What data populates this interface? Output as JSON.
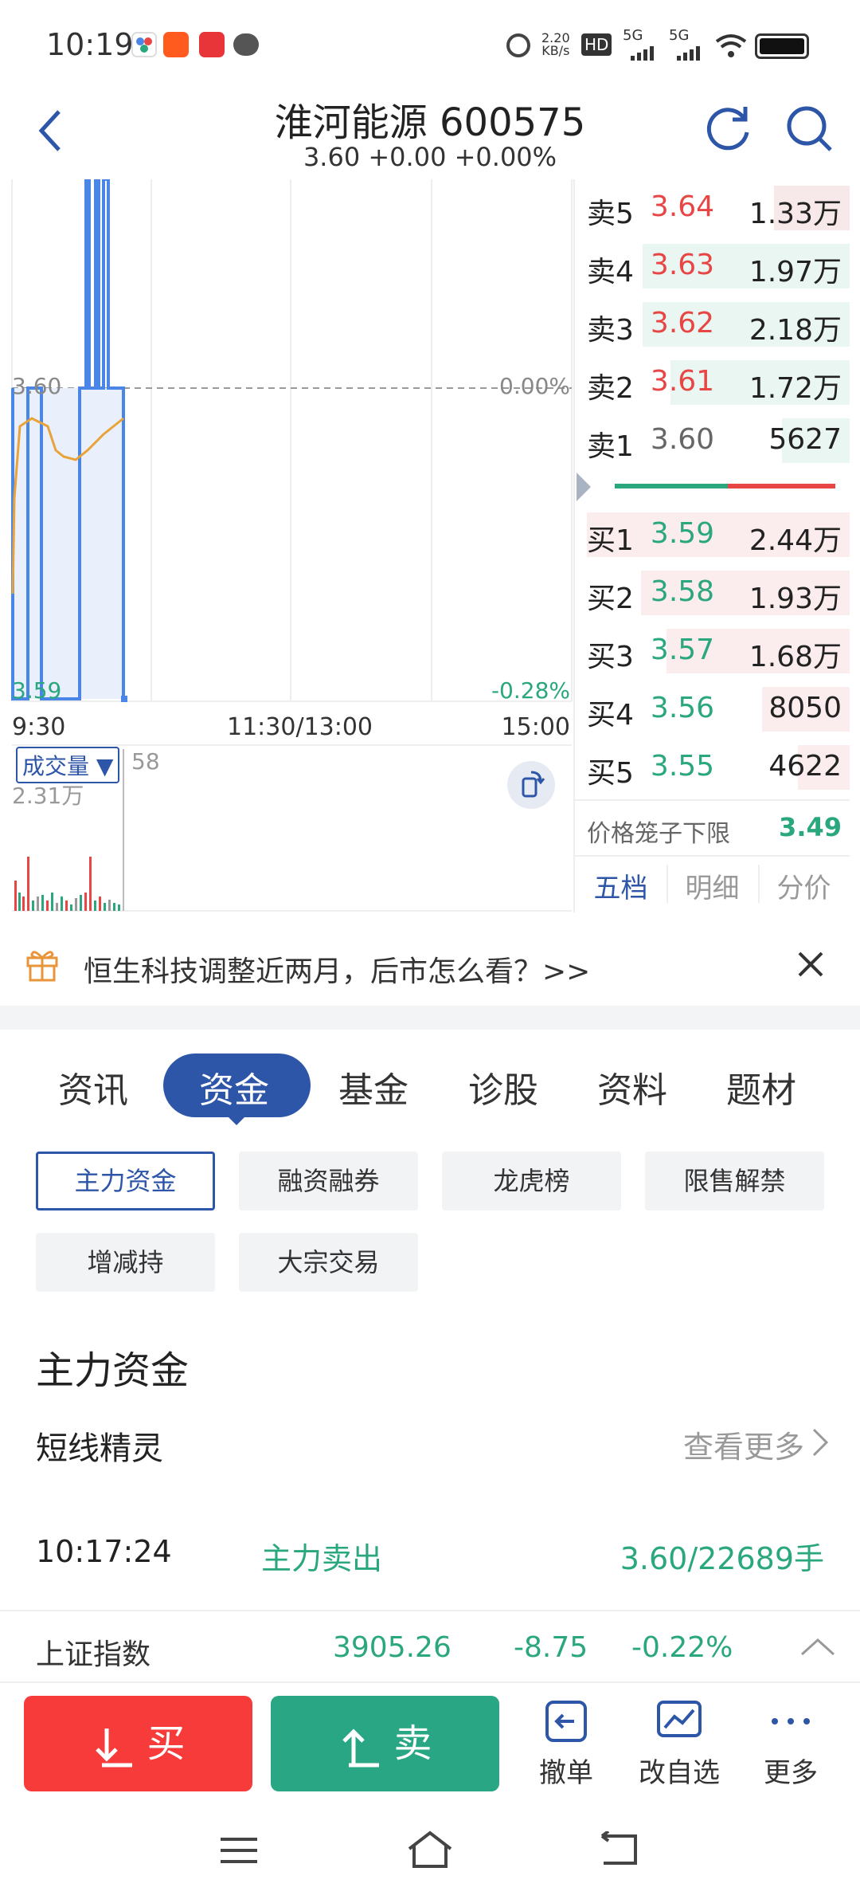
{
  "status_bar": {
    "time": "10:19",
    "speed_value": "2.20",
    "speed_unit": "KB/s",
    "hd": "HD",
    "net1": "5G",
    "net2": "5G",
    "icons": [
      "taobao-app-icon",
      "app-icon-2",
      "message-icon",
      "alarm-icon",
      "wifi-icon",
      "battery-icon"
    ]
  },
  "header": {
    "title": "淮河能源 600575",
    "subtitle": "3.60 +0.00 +0.00%"
  },
  "chart": {
    "price_top": "3.60",
    "pct_top": "0.00%",
    "price_bottom": "3.59",
    "pct_bottom": "-0.28%",
    "time_start": "9:30",
    "time_mid": "11:30/13:00",
    "time_end": "15:00",
    "volume_selector": "成交量 ▼",
    "volume_value": "58",
    "volume_max": "2.31万"
  },
  "chart_data": {
    "type": "line",
    "xlabel": "",
    "ylabel": "",
    "x_ticks": [
      "9:30",
      "11:30/13:00",
      "15:00"
    ],
    "ylim": [
      3.59,
      3.6
    ],
    "series": [],
    "avg_price_color": "#e8a33a",
    "price_color": "#4a86e8"
  },
  "orderbook": {
    "asks": [
      {
        "label": "卖5",
        "price": "3.64",
        "volume": "1.33万"
      },
      {
        "label": "卖4",
        "price": "3.63",
        "volume": "1.97万"
      },
      {
        "label": "卖3",
        "price": "3.62",
        "volume": "2.18万"
      },
      {
        "label": "卖2",
        "price": "3.61",
        "volume": "1.72万"
      },
      {
        "label": "卖1",
        "price": "3.60",
        "volume": "5627"
      }
    ],
    "bids": [
      {
        "label": "买1",
        "price": "3.59",
        "volume": "2.44万"
      },
      {
        "label": "买2",
        "price": "3.58",
        "volume": "1.93万"
      },
      {
        "label": "买3",
        "price": "3.57",
        "volume": "1.68万"
      },
      {
        "label": "买4",
        "price": "3.56",
        "volume": "8050"
      },
      {
        "label": "买5",
        "price": "3.55",
        "volume": "4622"
      }
    ],
    "limit_label": "价格笼子下限",
    "limit_value": "3.49",
    "tabs": [
      "五档",
      "明细",
      "分价"
    ]
  },
  "banner": {
    "text": "恒生科技调整近两月，后市怎么看？>>"
  },
  "main_tabs": [
    "资讯",
    "资金",
    "基金",
    "诊股",
    "资料",
    "题材"
  ],
  "chips": [
    "主力资金",
    "融资融券",
    "龙虎榜",
    "限售解禁",
    "增减持",
    "大宗交易"
  ],
  "section": {
    "title": "主力资金",
    "subtitle": "短线精灵",
    "more": "查看更多"
  },
  "flow": {
    "time": "10:17:24",
    "type": "主力卖出",
    "detail": "3.60/22689手"
  },
  "index_bar": {
    "name": "上证指数",
    "value": "3905.26",
    "change": "-8.75",
    "pct": "-0.22%"
  },
  "actions": {
    "buy": "买",
    "sell": "卖",
    "cancel": "撤单",
    "edit_watch": "改自选",
    "more": "更多"
  },
  "colors": {
    "red": "#e84545",
    "green": "#2aa77e",
    "blue": "#2d56a8"
  }
}
